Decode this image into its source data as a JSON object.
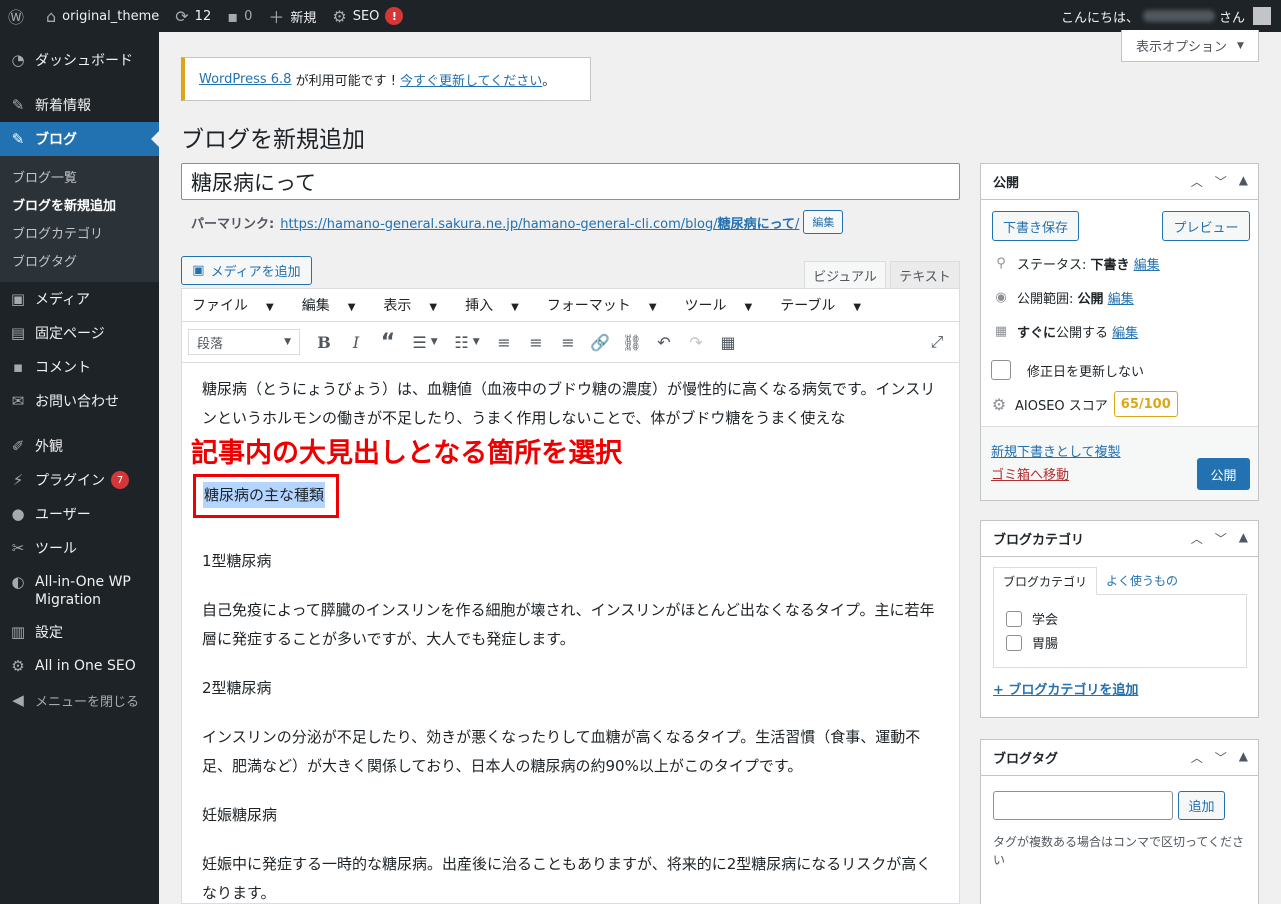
{
  "adminbar": {
    "site_name": "original_theme",
    "updates_count": "12",
    "comments_count": "0",
    "new_label": "新規",
    "seo_label": "SEO",
    "seo_badge": "!",
    "greeting": "こんにちは、",
    "greeting_suffix": "さん"
  },
  "sidebar": {
    "dashboard": "ダッシュボード",
    "news": "新着情報",
    "blog": "ブログ",
    "blog_sub": [
      "ブログ一覧",
      "ブログを新規追加",
      "ブログカテゴリ",
      "ブログタグ"
    ],
    "media": "メディア",
    "pages": "固定ページ",
    "comments": "コメント",
    "contact": "お問い合わせ",
    "appearance": "外観",
    "plugins": "プラグイン",
    "plugins_badge": "7",
    "users": "ユーザー",
    "tools": "ツール",
    "migration_line1": "All-in-One WP",
    "migration_line2": "Migration",
    "settings": "設定",
    "aioseo": "All in One SEO",
    "collapse": "メニューを閉じる"
  },
  "screen_options": "表示オプション",
  "notice": {
    "link1": "WordPress 6.8",
    "text": " が利用可能です ! ",
    "link2": "今すぐ更新してください",
    "end": "。"
  },
  "page_title": "ブログを新規追加",
  "post_title": "糖尿病にって",
  "permalink": {
    "label": "パーマリンク:",
    "url": "https://hamano-general.sakura.ne.jp/hamano-general-cli.com/blog/",
    "slug": "糖尿病にって",
    "slash": "/",
    "edit": "編集"
  },
  "editor": {
    "add_media": "メディアを追加",
    "tab_visual": "ビジュアル",
    "tab_text": "テキスト",
    "menus": [
      "ファイル",
      "編集",
      "表示",
      "挿入",
      "フォーマット",
      "ツール",
      "テーブル"
    ],
    "format_select": "段落",
    "content": {
      "p1": "糖尿病（とうにょうびょう）は、血糖値（血液中のブドウ糖の濃度）が慢性的に高くなる病気です。インスリンというホルモンの働きが不足したり、うまく作用しないことで、体がブドウ糖をうまく使えな",
      "annotation": "記事内の大見出しとなる箇所を選択",
      "selected": "糖尿病の主な種類",
      "h_type1": "1型糖尿病",
      "p_type1": "自己免疫によって膵臓のインスリンを作る細胞が壊され、インスリンがほとんど出なくなるタイプ。主に若年層に発症することが多いですが、大人でも発症します。",
      "h_type2": "2型糖尿病",
      "p_type2": "インスリンの分泌が不足したり、効きが悪くなったりして血糖が高くなるタイプ。生活習慣（食事、運動不足、肥満など）が大きく関係しており、日本人の糖尿病の約90%以上がこのタイプです。",
      "h_gest": "妊娠糖尿病",
      "p_gest": "妊娠中に発症する一時的な糖尿病。出産後に治ることもありますが、将来的に2型糖尿病になるリスクが高くなります。"
    }
  },
  "publish": {
    "title": "公開",
    "save_draft": "下書き保存",
    "preview": "プレビュー",
    "status_label": "ステータス:",
    "status_value": "下書き",
    "visibility_label": "公開範囲:",
    "visibility_value": "公開",
    "schedule_bold": "すぐに",
    "schedule_text": "公開する",
    "edit": "編集",
    "no_update_date": "修正日を更新しない",
    "aioseo_label": "AIOSEO スコア",
    "aioseo_score": "65/100",
    "duplicate": "新規下書きとして複製",
    "trash": "ゴミ箱へ移動",
    "publish_button": "公開"
  },
  "categories": {
    "title": "ブログカテゴリ",
    "tab_all": "ブログカテゴリ",
    "tab_popular": "よく使うもの",
    "items": [
      "学会",
      "胃腸"
    ],
    "add_link": "+ ブログカテゴリを追加"
  },
  "tags": {
    "title": "ブログタグ",
    "add_button": "追加",
    "help": "タグが複数ある場合はコンマで区切ってください"
  }
}
